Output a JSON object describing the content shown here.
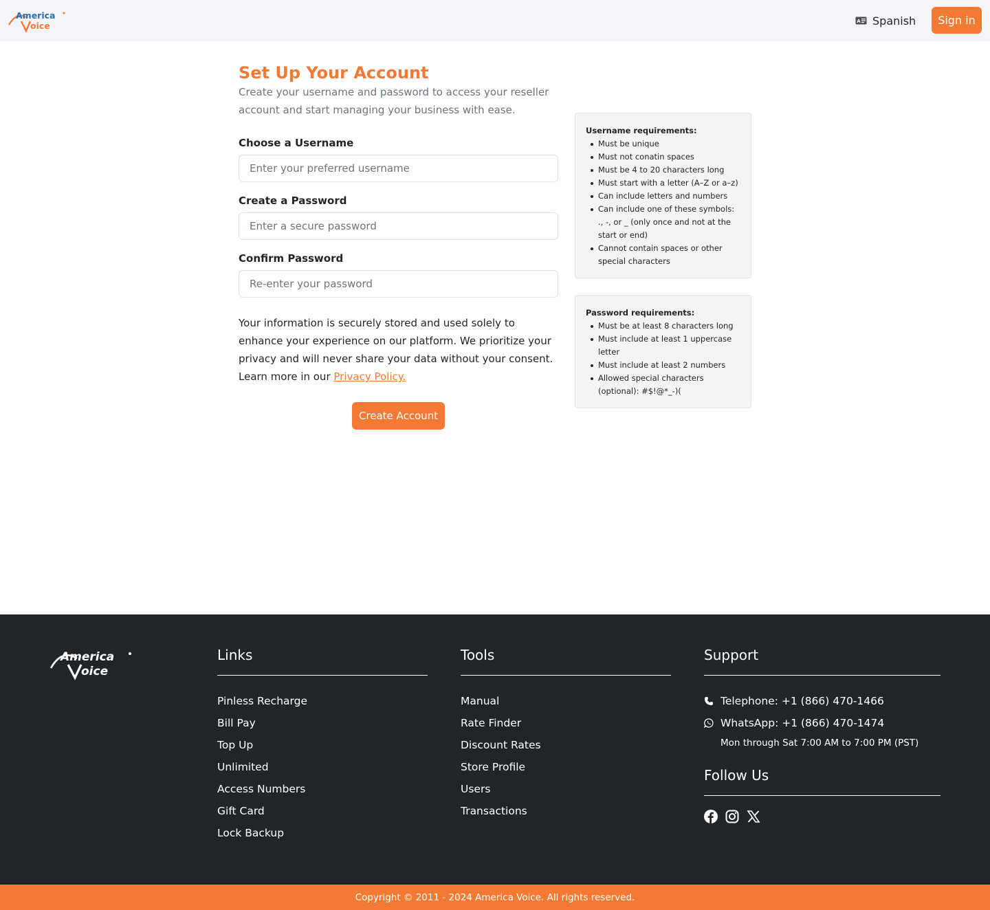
{
  "header": {
    "logo_alt": "America Voice",
    "language_label": "Spanish",
    "signin_label": "Sign in"
  },
  "form": {
    "title": "Set Up Your Account",
    "subtitle": "Create your username and password to access your reseller account and start managing your business with ease.",
    "username_label": "Choose a Username",
    "username_placeholder": "Enter your preferred username",
    "password_label": "Create a Password",
    "password_placeholder": "Enter a secure password",
    "confirm_label": "Confirm Password",
    "confirm_placeholder": "Re-enter your password",
    "info_text": "Your information is securely stored and used solely to enhance your experience on our platform. We prioritize your privacy and will never share your data without your consent. Learn more in our ",
    "privacy_link": "Privacy Policy.",
    "submit_label": "Create Account"
  },
  "username_requirements": {
    "title": "Username requirements:",
    "items": [
      "Must be unique",
      "Must not conatin spaces",
      "Must be 4 to 20 characters long",
      "Must start with a letter (A–Z or a–z)",
      "Can include letters and numbers",
      "Can include one of these symbols: ., -, or _ (only once and not at the start or end)",
      "Cannot contain spaces or other special characters"
    ]
  },
  "password_requirements": {
    "title": "Password requirements:",
    "items": [
      "Must be at least 8 characters long",
      "Must include at least 1 uppercase letter",
      "Must include at least 2 numbers",
      "Allowed special characters (optional): #$!@*_-)("
    ]
  },
  "footer": {
    "links_title": "Links",
    "links": [
      "Pinless Recharge",
      "Bill Pay",
      "Top Up",
      "Unlimited",
      "Access Numbers",
      "Gift Card",
      "Lock Backup"
    ],
    "tools_title": "Tools",
    "tools": [
      "Manual",
      "Rate Finder",
      "Discount Rates",
      "Store Profile",
      "Users",
      "Transactions"
    ],
    "support_title": "Support",
    "telephone": "Telephone: +1 (866) 470-1466",
    "whatsapp": "WhatsApp: +1 (866) 470-1474",
    "hours": "Mon through Sat 7:00 AM to 7:00 PM (PST)",
    "follow_title": "Follow Us",
    "social_icons": [
      "facebook-icon",
      "instagram-icon",
      "x-icon"
    ],
    "copyright": "Copyright © 2011 - 2024 America Voice. All rights reserved."
  },
  "colors": {
    "accent": "#f47a33",
    "footer_bg": "#212529",
    "header_bg": "#f4f5fb"
  }
}
